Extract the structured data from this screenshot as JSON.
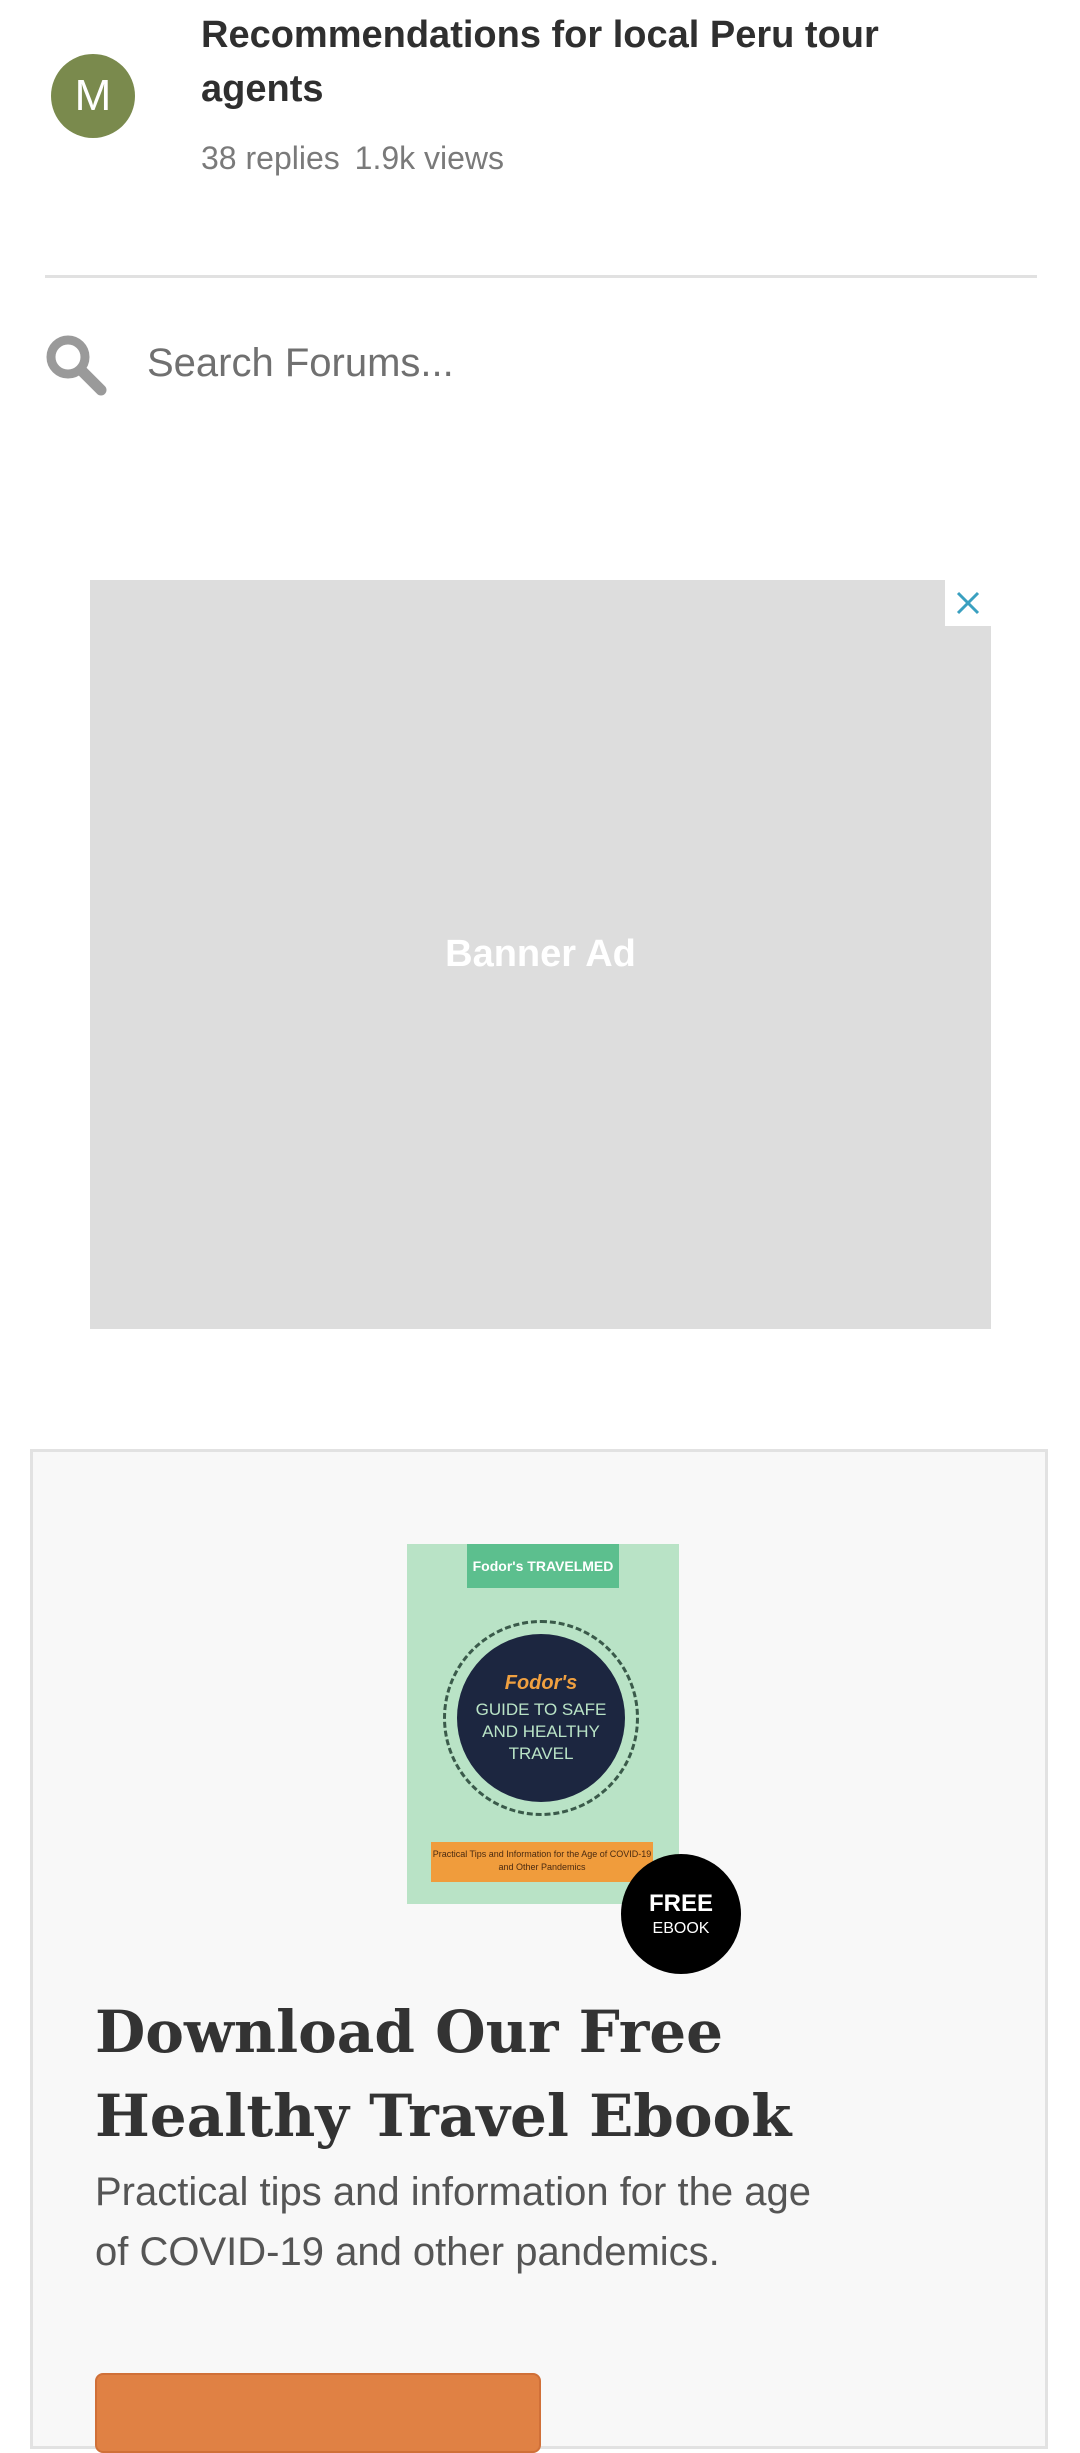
{
  "thread": {
    "avatar_initial": "M",
    "title": "Recommendations for local Peru tour agents",
    "replies": "38 replies",
    "views": "1.9k views"
  },
  "search": {
    "placeholder": "Search Forums..."
  },
  "ad": {
    "label": "Banner Ad",
    "close_icon": "close-icon"
  },
  "promo": {
    "cover": {
      "top_text": "Fodor's TRAVELMED",
      "brand": "Fodor's",
      "title": "GUIDE TO SAFE AND HEALTHY TRAVEL",
      "banner_text": "Practical Tips and Information for the Age of COVID-19 and Other Pandemics"
    },
    "badge_main": "FREE",
    "badge_sub": "EBOOK",
    "heading": "Download Our Free Healthy Travel Ebook",
    "description": "Practical tips and information for the age of COVID-19 and other pandemics."
  },
  "colors": {
    "avatar": "#7a8a4d",
    "ad_close_icon": "#3aa0c0",
    "button": "#e08144"
  }
}
